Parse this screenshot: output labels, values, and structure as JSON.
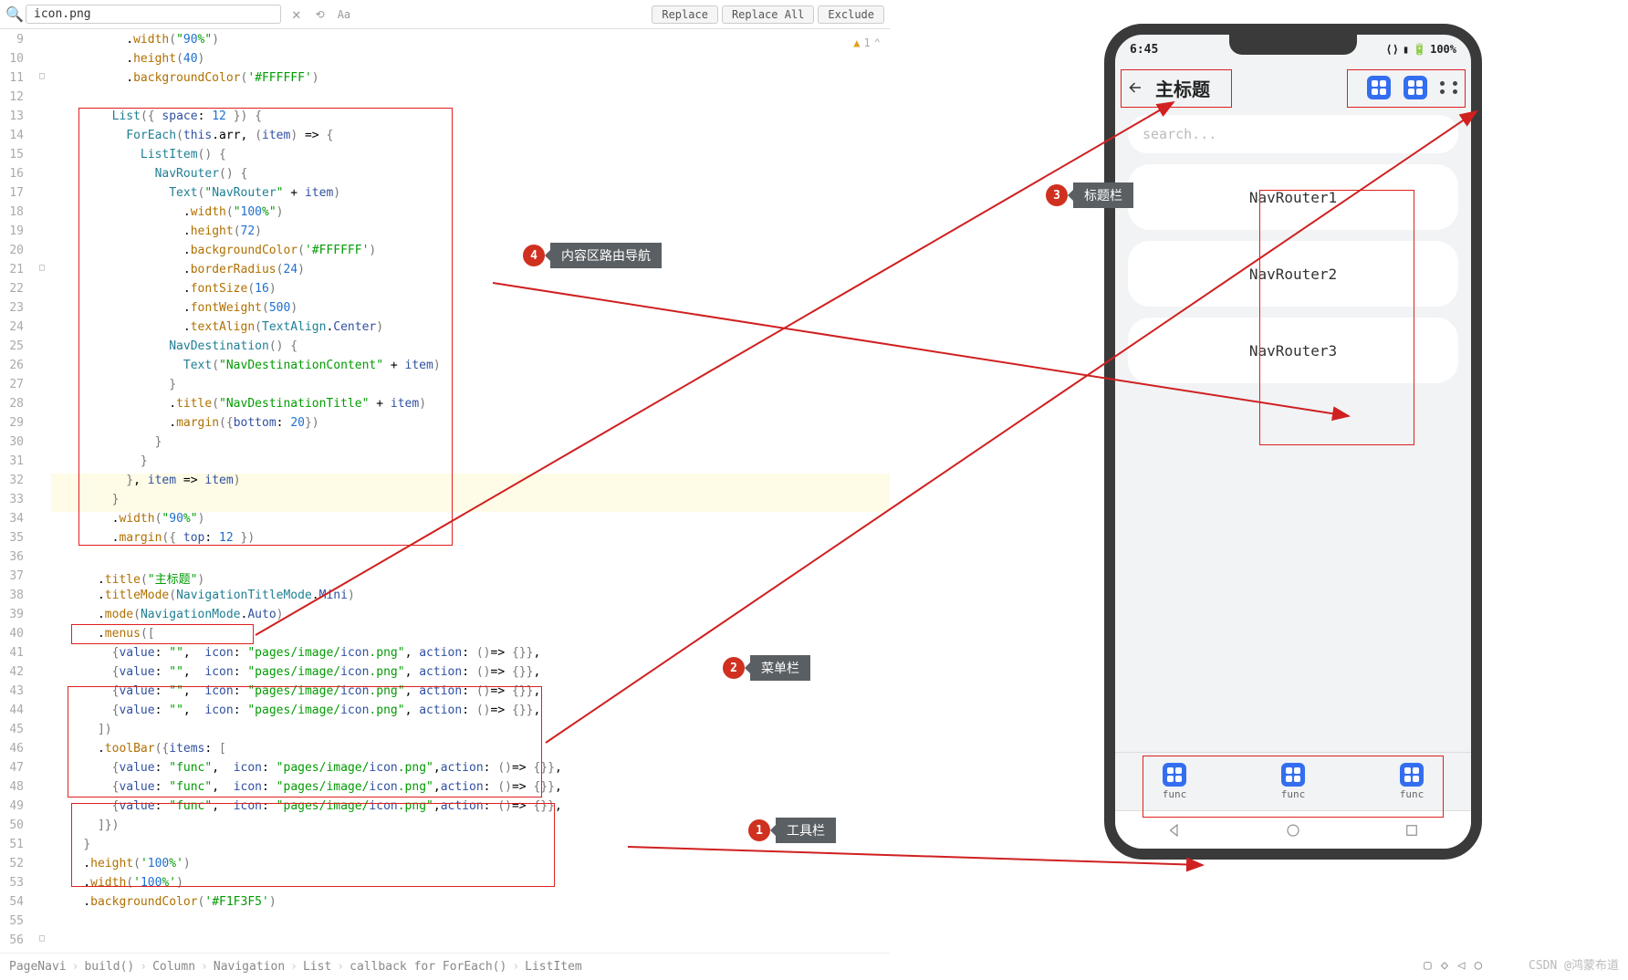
{
  "search": {
    "value": "icon.png",
    "replace": "Replace",
    "replace_all": "Replace All",
    "exclude": "Exclude",
    "aa": "Aa"
  },
  "warn": {
    "count": "1"
  },
  "callouts": {
    "c1": {
      "num": "1",
      "label": "工具栏"
    },
    "c2": {
      "num": "2",
      "label": "菜单栏"
    },
    "c3": {
      "num": "3",
      "label": "标题栏"
    },
    "c4": {
      "num": "4",
      "label": "内容区路由导航"
    }
  },
  "breadcrumb": [
    "PageNavi",
    "build()",
    "Column",
    "Navigation",
    "List",
    "callback for ForEach()",
    "ListItem"
  ],
  "phone": {
    "time": "6:45",
    "battery": "100%",
    "title": "主标题",
    "search_ph": "search...",
    "items": [
      "NavRouter1",
      "NavRouter2",
      "NavRouter3"
    ],
    "toolbar_label": "func"
  },
  "watermark": "CSDN @鸿蒙布道",
  "code": {
    "l9": "          .width(\"90%\")",
    "l10": "          .height(40)",
    "l11": "          .backgroundColor('#FFFFFF')",
    "l12": "",
    "l13": "        List({ space: 12 }) {",
    "l14": "          ForEach(this.arr, (item) => {",
    "l15": "            ListItem() {",
    "l16": "              NavRouter() {",
    "l17": "                Text(\"NavRouter\" + item)",
    "l18": "                  .width(\"100%\")",
    "l19": "                  .height(72)",
    "l20": "                  .backgroundColor('#FFFFFF')",
    "l21": "                  .borderRadius(24)",
    "l22": "                  .fontSize(16)",
    "l23": "                  .fontWeight(500)",
    "l24": "                  .textAlign(TextAlign.Center)",
    "l25": "                NavDestination() {",
    "l26": "                  Text(\"NavDestinationContent\" + item)",
    "l27": "                }",
    "l28": "                .title(\"NavDestinationTitle\" + item)",
    "l29": "                .margin({bottom: 20})",
    "l30": "              }",
    "l31": "            }",
    "l32": "          }, item => item)",
    "l33": "        }",
    "l34": "        .width(\"90%\")",
    "l35": "        .margin({ top: 12 })",
    "l36": "",
    "l37": "      .title(\"主标题\")",
    "l38": "      .titleMode(NavigationTitleMode.Mini)",
    "l39": "      .mode(NavigationMode.Auto)",
    "l40": "      .menus([",
    "l41": "        {value: \"\",  icon: \"pages/image/icon.png\", action: ()=> {}},",
    "l42": "        {value: \"\",  icon: \"pages/image/icon.png\", action: ()=> {}},",
    "l43": "        {value: \"\",  icon: \"pages/image/icon.png\", action: ()=> {}},",
    "l44": "        {value: \"\",  icon: \"pages/image/icon.png\", action: ()=> {}},",
    "l45": "      ])",
    "l46": "      .toolBar({items: [",
    "l47": "        {value: \"func\",  icon: \"pages/image/icon.png\",action: ()=> {}},",
    "l48": "        {value: \"func\",  icon: \"pages/image/icon.png\",action: ()=> {}},",
    "l49": "        {value: \"func\",  icon: \"pages/image/icon.png\",action: ()=> {}},",
    "l50": "      ]})",
    "l51": "    }",
    "l52": "    .height('100%')",
    "l53": "    .width('100%')",
    "l54": "    .backgroundColor('#F1F3F5')"
  }
}
